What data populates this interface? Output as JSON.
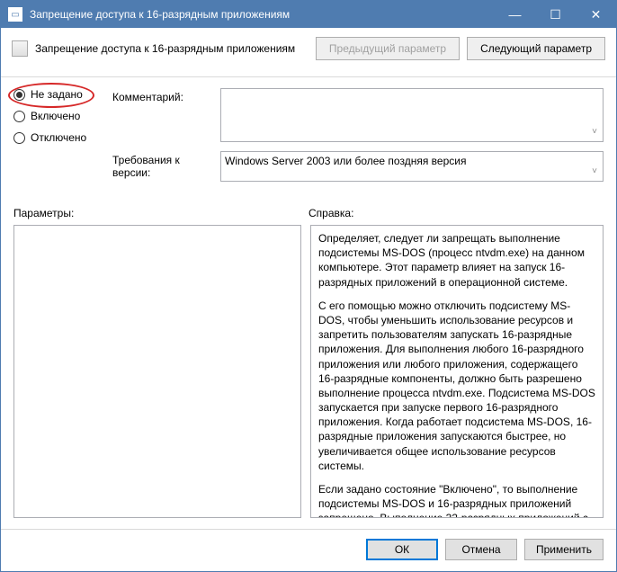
{
  "window": {
    "title": "Запрещение доступа к 16-разрядным приложениям"
  },
  "header": {
    "title": "Запрещение доступа к 16-разрядным приложениям",
    "prev": "Предыдущий параметр",
    "next": "Следующий параметр"
  },
  "radios": {
    "not_configured": "Не задано",
    "enabled": "Включено",
    "disabled": "Отключено"
  },
  "labels": {
    "comment": "Комментарий:",
    "supported": "Требования к версии:",
    "options": "Параметры:",
    "help": "Справка:"
  },
  "supported_text": "Windows Server 2003 или более поздняя версия",
  "help_paragraphs": [
    "Определяет, следует ли запрещать выполнение подсистемы MS-DOS (процесс ntvdm.exe) на данном компьютере. Этот параметр влияет на запуск 16-разрядных приложений в операционной системе.",
    "С его помощью можно отключить подсистему MS-DOS, чтобы уменьшить использование ресурсов и запретить пользователям запускать 16-разрядные приложения. Для выполнения любого 16-разрядного приложения или любого приложения, содержащего 16-разрядные компоненты, должно быть разрешено выполнение процесса ntvdm.exe. Подсистема MS-DOS запускается при запуске первого 16-разрядного приложения. Когда работает подсистема MS-DOS, 16-разрядные приложения запускаются быстрее, но увеличивается общее использование ресурсов системы.",
    "Если задано состояние \"Включено\", то выполнение подсистемы MS-DOS и 16-разрядных приложений запрещено. Выполнение 32-разрядных приложений с 16-разрядными программами установки или другими 16-разрядными компонентами также невозможно."
  ],
  "buttons": {
    "ok": "ОК",
    "cancel": "Отмена",
    "apply": "Применить"
  }
}
